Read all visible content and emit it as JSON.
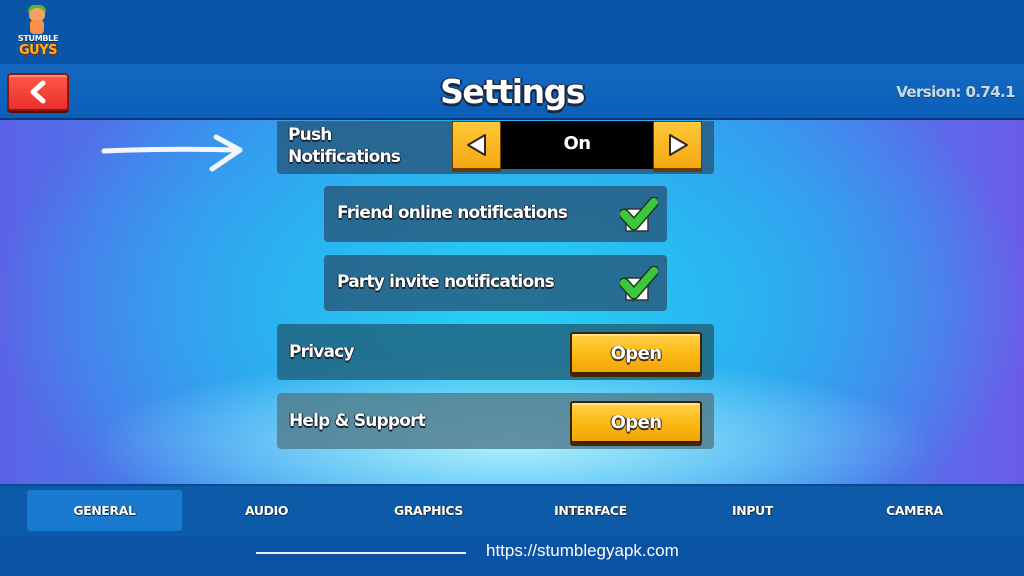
{
  "logo": {
    "line1": "STUMBLE",
    "line2": "GUYS",
    "icon": "stumble-guys-logo"
  },
  "header": {
    "back_icon": "chevron-left-icon",
    "title": "Settings",
    "version": "Version: 0.74.1"
  },
  "settings": {
    "push_notifications": {
      "label_line1": "Push",
      "label_line2": "Notifications",
      "value": "On",
      "prev_icon": "triangle-left-icon",
      "next_icon": "triangle-right-icon"
    },
    "friend_online": {
      "label": "Friend online notifications",
      "checked": true
    },
    "party_invite": {
      "label": "Party invite notifications",
      "checked": true
    },
    "privacy": {
      "label": "Privacy",
      "button": "Open"
    },
    "help_support": {
      "label": "Help & Support",
      "button": "Open"
    }
  },
  "annotation": {
    "icon": "arrow-right-icon"
  },
  "tabs": [
    {
      "label": "GENERAL",
      "active": true
    },
    {
      "label": "AUDIO",
      "active": false
    },
    {
      "label": "GRAPHICS",
      "active": false
    },
    {
      "label": "INTERFACE",
      "active": false
    },
    {
      "label": "INPUT",
      "active": false
    },
    {
      "label": "CAMERA",
      "active": false
    }
  ],
  "footer": {
    "url": "https://stumblegyapk.com"
  },
  "colors": {
    "accent_yellow": "#fbb812",
    "back_red": "#e8302a",
    "check_green": "#3cc83c",
    "tab_active": "#1a7ad0"
  }
}
